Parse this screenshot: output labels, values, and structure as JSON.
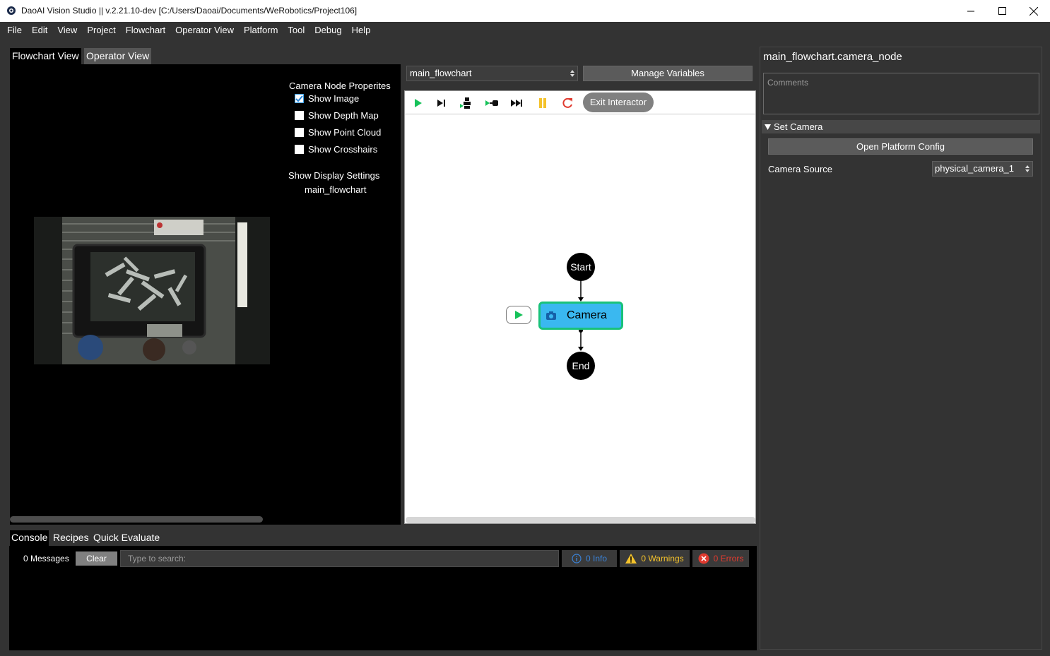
{
  "window": {
    "title": "DaoAI Vision Studio || v.2.21.10-dev   [C:/Users/Daoai/Documents/WeRobotics/Project106]"
  },
  "menu": [
    "File",
    "Edit",
    "View",
    "Project",
    "Flowchart",
    "Operator View",
    "Platform",
    "Tool",
    "Debug",
    "Help"
  ],
  "left_tabs": {
    "flowchart_view": "Flowchart View",
    "operator_view": "Operator View"
  },
  "camera_props": {
    "heading": "Camera Node Properites",
    "show_image": "Show Image",
    "show_image_checked": true,
    "show_depth_map": "Show Depth Map",
    "show_point_cloud": "Show Point Cloud",
    "show_crosshairs": "Show Crosshairs",
    "display_settings": "Show Display Settings",
    "flowchart_name": "main_flowchart"
  },
  "center": {
    "flowchart_select": "main_flowchart",
    "manage_variables": "Manage Variables",
    "exit_interactor": "Exit Interactor",
    "nodes": {
      "start": "Start",
      "camera": "Camera",
      "end": "End"
    },
    "colors": {
      "camera_node_fill": "#3ab8f0",
      "camera_node_border": "#19c27a",
      "play": "#17c25a",
      "pause": "#f4c22b",
      "reset": "#e03a2f"
    }
  },
  "right": {
    "node_title": "main_flowchart.camera_node",
    "comments_placeholder": "Comments",
    "section": "Set Camera",
    "open_platform_config": "Open Platform Config",
    "camera_source_label": "Camera Source",
    "camera_source_value": "physical_camera_1"
  },
  "bottom_tabs": {
    "console": "Console",
    "recipes": "Recipes",
    "quick_evaluate": "Quick Evaluate"
  },
  "console": {
    "messages": "0 Messages",
    "clear": "Clear",
    "search_placeholder": "Type to search:",
    "info": "0 Info",
    "warnings": "0 Warnings",
    "errors": "0 Errors"
  }
}
